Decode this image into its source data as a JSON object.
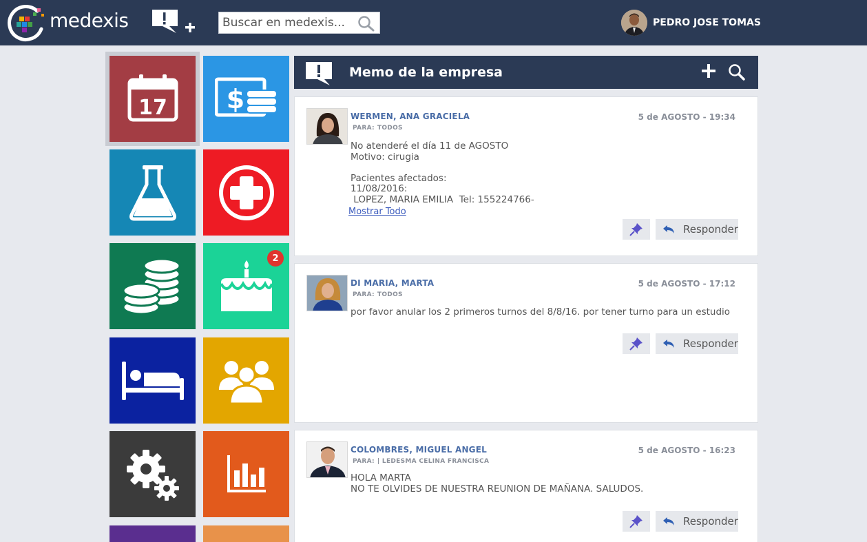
{
  "app": {
    "brand": "medexis",
    "search_placeholder": "Buscar en medexis...",
    "user_name": "PEDRO JOSE TOMAS"
  },
  "colors": {
    "topbar": "#2b3a55",
    "calendar_tile": "#a33d44",
    "billing_tile": "#2b96e4",
    "lab_tile": "#1587b5",
    "emergency_tile": "#ee1b24",
    "finance_tile": "#0f7a52",
    "birthday_tile": "#1bd397",
    "hospital_tile": "#0b22a0",
    "patients_tile": "#e3a600",
    "settings_tile": "#3b3b3b",
    "reports_tile": "#e25a1c",
    "author_link": "#4a6da7"
  },
  "tiles": [
    {
      "icon": "calendar-icon",
      "day": "17"
    },
    {
      "icon": "billing-icon"
    },
    {
      "icon": "lab-flask-icon"
    },
    {
      "icon": "medical-cross-icon"
    },
    {
      "icon": "coins-icon"
    },
    {
      "icon": "birthday-cake-icon",
      "badge": "2"
    },
    {
      "icon": "hospital-bed-icon"
    },
    {
      "icon": "patients-group-icon"
    },
    {
      "icon": "settings-gears-icon"
    },
    {
      "icon": "bar-chart-icon"
    }
  ],
  "panel": {
    "title": "Memo de la empresa"
  },
  "memos": [
    {
      "author": "WERMEN, ANA GRACIELA",
      "date": "5 de AGOSTO - 19:34",
      "to_label": "PARA:",
      "to": "TODOS",
      "body": "No atenderé el día 11 de AGOSTO\nMotivo: cirugia\n\nPacientes afectados:\n11/08/2016:\n LOPEZ, MARIA EMILIA  Tel: 155224766-",
      "show_all": "Mostrar Todo",
      "reply_label": "Responder"
    },
    {
      "author": "DI MARIA, MARTA",
      "date": "5 de AGOSTO - 17:12",
      "to_label": "PARA:",
      "to": "TODOS",
      "body": "por favor anular los 2 primeros turnos del 8/8/16. por tener turno para un estudio",
      "reply_label": "Responder"
    },
    {
      "author": "COLOMBRES, MIGUEL ANGEL",
      "date": "5 de AGOSTO - 16:23",
      "to_label": "PARA:",
      "to": "| LEDESMA CELINA FRANCISCA",
      "body": "HOLA MARTA\nNO TE OLVIDES DE NUESTRA REUNION DE MAÑANA. SALUDOS.",
      "reply_label": "Responder"
    }
  ]
}
